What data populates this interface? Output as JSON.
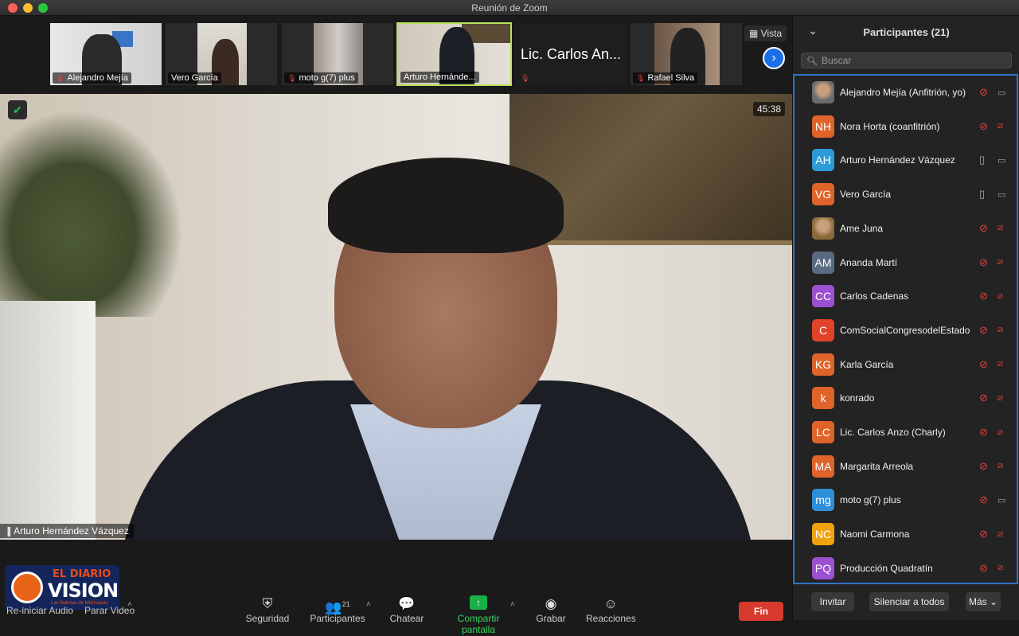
{
  "window": {
    "title": "Reunión de Zoom"
  },
  "colors": {
    "accent": "#2d74c7",
    "danger": "#d83b2d",
    "mute_red": "#e04343",
    "share_green": "#19b04a"
  },
  "strip": {
    "thumbs": [
      {
        "name": "Alejandro Mejía",
        "muted": true
      },
      {
        "name": "Vero García",
        "muted": false
      },
      {
        "name": "moto g(7) plus",
        "muted": true
      },
      {
        "name": "Arturo Hernánde...",
        "muted": false,
        "active": true
      },
      {
        "name": "Lic. Carlos An...",
        "name_only": true
      },
      {
        "name": "Rafael Silva",
        "muted": true
      }
    ],
    "view_label": "Vista"
  },
  "video": {
    "timer": "45:38",
    "speaker": "Arturo Hernández Vázquez"
  },
  "toolbar": {
    "reiniciar_audio": "Re-iniciar Audio",
    "parar_video": "Parar Video",
    "seguridad": "Seguridad",
    "participantes": "Participantes",
    "participant_count": "21",
    "chatear": "Chatear",
    "compartir": "Compartir pantalla",
    "grabar": "Grabar",
    "reacciones": "Reacciones",
    "fin": "Fin"
  },
  "logo": {
    "line1": "EL DIARIO",
    "line2": "VISION",
    "line3": "Las Noticias de Michoacán"
  },
  "panel": {
    "title": "Participantes (21)",
    "search_placeholder": "Buscar",
    "participants": [
      {
        "initials": "",
        "name": "Alejandro Mejía (Anfitrión, yo)",
        "color": "#6b6b6b",
        "photo": true,
        "mic": "muted",
        "cam": "on"
      },
      {
        "initials": "NH",
        "name": "Nora Horta (coanfitrión)",
        "color": "#e0632a",
        "mic": "muted",
        "cam": "off"
      },
      {
        "initials": "AH",
        "name": "Arturo Hernández Vázquez",
        "color": "#2e9bd8",
        "mic": "on",
        "cam": "on"
      },
      {
        "initials": "VG",
        "name": "Vero García",
        "color": "#e0632a",
        "mic": "on",
        "cam": "on"
      },
      {
        "initials": "",
        "name": "Ame Juna",
        "color": "#8a6a3a",
        "photo": true,
        "mic": "muted",
        "cam": "off"
      },
      {
        "initials": "AM",
        "name": "Ananda Martí",
        "color": "#5a6a80",
        "mic": "muted",
        "cam": "off"
      },
      {
        "initials": "CC",
        "name": "Carlos Cadenas",
        "color": "#9c4fd0",
        "mic": "muted",
        "cam": "off"
      },
      {
        "initials": "C",
        "name": "ComSocialCongresodelEstado",
        "color": "#e0432a",
        "mic": "muted",
        "cam": "off"
      },
      {
        "initials": "KG",
        "name": "Karla García",
        "color": "#e0632a",
        "mic": "muted",
        "cam": "off"
      },
      {
        "initials": "k",
        "name": "konrado",
        "color": "#e0632a",
        "mic": "muted",
        "cam": "off"
      },
      {
        "initials": "LC",
        "name": "Lic. Carlos Anzo (Charly)",
        "color": "#e0632a",
        "mic": "muted",
        "cam": "off"
      },
      {
        "initials": "MA",
        "name": "Margarita Arreola",
        "color": "#e0632a",
        "mic": "muted",
        "cam": "off"
      },
      {
        "initials": "mg",
        "name": "moto g(7) plus",
        "color": "#2e8fd8",
        "mic": "muted",
        "cam": "on"
      },
      {
        "initials": "NC",
        "name": "Naomi Carmona",
        "color": "#f0a20f",
        "mic": "muted",
        "cam": "off"
      },
      {
        "initials": "PQ",
        "name": "Producción Quadratín",
        "color": "#9c4fd0",
        "mic": "muted",
        "cam": "off"
      }
    ],
    "footer": {
      "invitar": "Invitar",
      "silenciar": "Silenciar a todos",
      "mas": "Más"
    }
  }
}
